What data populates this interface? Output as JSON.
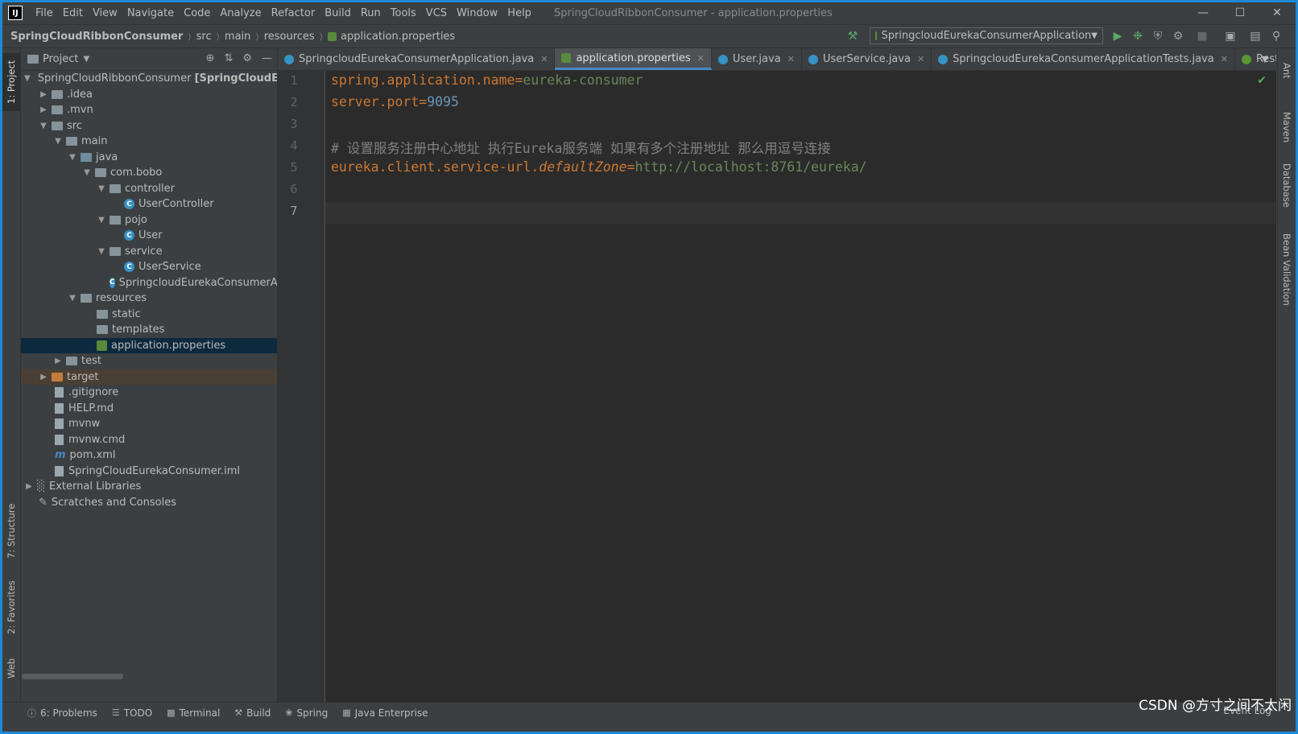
{
  "menu": [
    "File",
    "Edit",
    "View",
    "Navigate",
    "Code",
    "Analyze",
    "Refactor",
    "Build",
    "Run",
    "Tools",
    "VCS",
    "Window",
    "Help"
  ],
  "window_title": "SpringCloudRibbonConsumer - application.properties",
  "breadcrumbs": [
    "SpringCloudRibbonConsumer",
    "src",
    "main",
    "resources",
    "application.properties"
  ],
  "run_config": "SpringcloudEurekaConsumerApplication",
  "project_panel": {
    "title": "Project",
    "tree": [
      {
        "label": "SpringCloudRibbonConsumer",
        "extra": "[SpringCloudEure"
      },
      {
        "label": ".idea"
      },
      {
        "label": ".mvn"
      },
      {
        "label": "src"
      },
      {
        "label": "main"
      },
      {
        "label": "java"
      },
      {
        "label": "com.bobo"
      },
      {
        "label": "controller"
      },
      {
        "label": "UserController"
      },
      {
        "label": "pojo"
      },
      {
        "label": "User"
      },
      {
        "label": "service"
      },
      {
        "label": "UserService"
      },
      {
        "label": "SpringcloudEurekaConsumerApp"
      },
      {
        "label": "resources"
      },
      {
        "label": "static"
      },
      {
        "label": "templates"
      },
      {
        "label": "application.properties"
      },
      {
        "label": "test"
      },
      {
        "label": "target"
      },
      {
        "label": ".gitignore"
      },
      {
        "label": "HELP.md"
      },
      {
        "label": "mvnw"
      },
      {
        "label": "mvnw.cmd"
      },
      {
        "label": "pom.xml"
      },
      {
        "label": "SpringCloudEurekaConsumer.iml"
      },
      {
        "label": "External Libraries"
      },
      {
        "label": "Scratches and Consoles"
      }
    ]
  },
  "left_tabs": [
    "1: Project",
    "7: Structure",
    "2: Favorites",
    "Web"
  ],
  "right_tabs": [
    "Ant",
    "Maven",
    "Database",
    "Bean Validation"
  ],
  "editor_tabs": [
    {
      "label": "SpringcloudEurekaConsumerApplication.java"
    },
    {
      "label": "application.properties"
    },
    {
      "label": "User.java"
    },
    {
      "label": "UserService.java"
    },
    {
      "label": "SpringcloudEurekaConsumerApplicationTests.java"
    },
    {
      "label": "RestOperations.cla"
    }
  ],
  "code": {
    "line_numbers": [
      "1",
      "2",
      "3",
      "4",
      "5",
      "6",
      "7"
    ],
    "l1_key": "spring.application.name",
    "l1_val": "eureka-consumer",
    "l2_key": "server.port",
    "l2_val": "9095",
    "l4_comment": "# 设置服务注册中心地址 执行Eureka服务端 如果有多个注册地址 那么用逗号连接",
    "l5_key": "eureka.client.service-url.",
    "l5_key_italic": "defaultZone",
    "l5_val": "http://localhost:8761/eureka/",
    "eq": "="
  },
  "bottom_tabs": [
    "6: Problems",
    "TODO",
    "Terminal",
    "Build",
    "Spring",
    "Java Enterprise"
  ],
  "event_log": "Event Log",
  "watermark": "CSDN @方寸之间不太闲"
}
